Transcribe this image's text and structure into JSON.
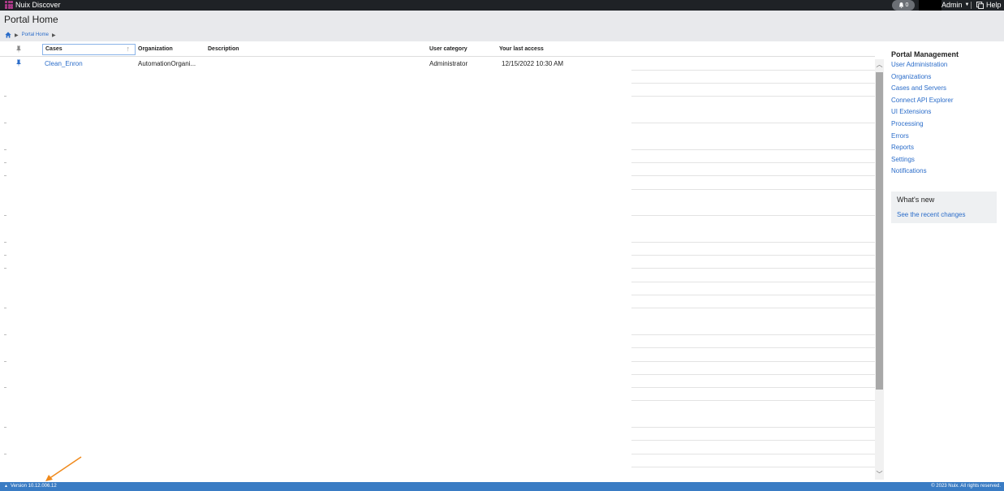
{
  "topbar": {
    "app_name": "Nuix Discover",
    "notification_count": "0",
    "user_label": "Admin",
    "help_label": "Help"
  },
  "header": {
    "title": "Portal Home",
    "breadcrumb": [
      "Portal Home"
    ]
  },
  "grid": {
    "columns": {
      "cases": "Cases",
      "organization": "Organization",
      "description": "Description",
      "user_category": "User category",
      "last_access": "Your last access"
    },
    "rows": [
      {
        "case": "Clean_Enron",
        "organization": "AutomationOrgani...",
        "description": "",
        "user_category": "Administrator",
        "last_access": "12/15/2022 10:30 AM"
      }
    ]
  },
  "portal_management": {
    "title": "Portal Management",
    "links": [
      "User Administration",
      "Organizations",
      "Cases and Servers",
      "Connect API Explorer",
      "UI Extensions",
      "Processing",
      "Errors",
      "Reports",
      "Settings",
      "Notifications"
    ]
  },
  "whats_new": {
    "title": "What's new",
    "link": "See the recent changes"
  },
  "footer": {
    "version": "Version 10.12.006.12",
    "copyright": "© 2023 Nuix. All rights reserved."
  },
  "colors": {
    "topbar": "#1f2226",
    "header": "#e8e9ec",
    "link": "#2a6cc9",
    "footer": "#3a7cc4",
    "annotation": "#f08a1c"
  }
}
